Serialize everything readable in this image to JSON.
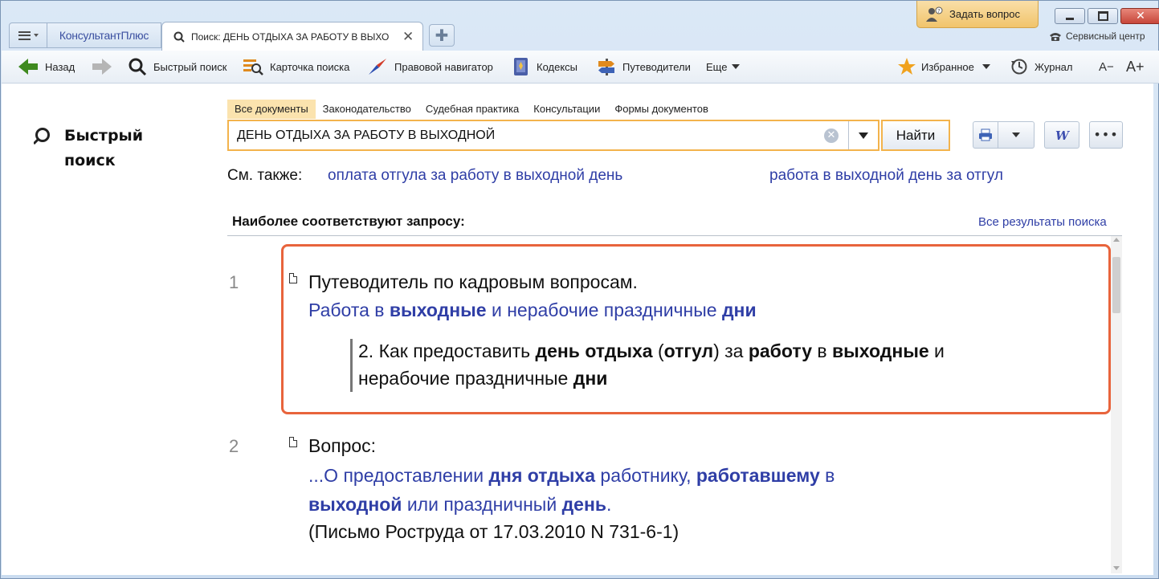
{
  "tabs": {
    "brand": "КонсультантПлюс",
    "active_title": "Поиск: ДЕНЬ ОТДЫХА ЗА РАБОТУ В ВЫХО",
    "close_glyph": "✕",
    "new_glyph": "✚"
  },
  "header": {
    "ask_label": "Задать вопрос",
    "service_label": "Сервисный центр"
  },
  "toolbar": {
    "back": "Назад",
    "quick_search": "Быстрый поиск",
    "search_card": "Карточка поиска",
    "legal_navigator": "Правовой навигатор",
    "codes": "Кодексы",
    "guides": "Путеводители",
    "more": "Еще",
    "favorites": "Избранное",
    "journal": "Журнал",
    "font_minus": "A−",
    "font_plus": "A+"
  },
  "sidebar": {
    "title_line1": "Быстрый",
    "title_line2": "поиск"
  },
  "filters": [
    "Все документы",
    "Законодательство",
    "Судебная практика",
    "Консультации",
    "Формы документов"
  ],
  "search": {
    "query": "ДЕНЬ ОТДЫХА ЗА РАБОТУ В ВЫХОДНОЙ",
    "find_label": "Найти"
  },
  "see_also": {
    "label": "См. также:",
    "link1": "оплата отгула за работу в выходной день",
    "link2": "работа в выходной день за отгул"
  },
  "results_header": {
    "title": "Наиболее соответствуют запросу:",
    "all_results": "Все результаты поиска"
  },
  "results": [
    {
      "num": "1",
      "title": "Путеводитель по кадровым вопросам.",
      "subtitle": [
        {
          "t": "Работа",
          "bold": false
        },
        {
          "t": " в ",
          "bold": false
        },
        {
          "t": "выходные",
          "bold": true
        },
        {
          "t": " и нерабочие праздничные ",
          "bold": false
        },
        {
          "t": "дни",
          "bold": true
        }
      ],
      "section_line1": [
        {
          "t": "2. Как предоставить ",
          "bold": false
        },
        {
          "t": "день отдыха",
          "bold": true
        },
        {
          "t": " (",
          "bold": false
        },
        {
          "t": "отгул",
          "bold": true
        },
        {
          "t": ") за ",
          "bold": false
        },
        {
          "t": "работу",
          "bold": true
        },
        {
          "t": " в ",
          "bold": false
        },
        {
          "t": "выходные",
          "bold": true
        },
        {
          "t": " и",
          "bold": false
        }
      ],
      "section_line2": [
        {
          "t": "нерабочие праздничные ",
          "bold": false
        },
        {
          "t": "дни",
          "bold": true
        }
      ]
    },
    {
      "num": "2",
      "title": "Вопрос:",
      "line1": [
        {
          "t": "...О предоставлении ",
          "bold": false
        },
        {
          "t": "дня отдыха",
          "bold": true
        },
        {
          "t": " работнику, ",
          "bold": false
        },
        {
          "t": "работавшему",
          "bold": true
        },
        {
          "t": " в",
          "bold": false
        }
      ],
      "line2": [
        {
          "t": "выходной",
          "bold": true
        },
        {
          "t": " или праздничный ",
          "bold": false
        },
        {
          "t": "день",
          "bold": true
        },
        {
          "t": ".",
          "bold": false
        }
      ],
      "source": "(Письмо Роструда от 17.03.2010 N 731-6-1)"
    }
  ],
  "colors": {
    "accent_orange": "#f3b34c",
    "highlight_border": "#e8643c",
    "link_blue": "#2f3ea6"
  }
}
